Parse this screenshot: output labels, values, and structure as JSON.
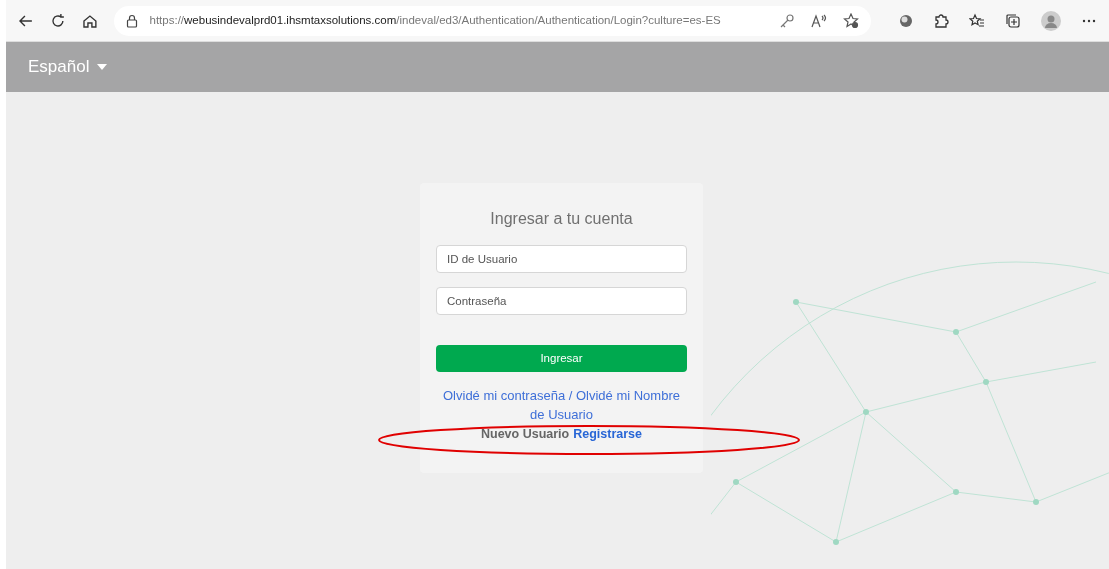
{
  "browser": {
    "url": {
      "scheme": "https://",
      "host": "webusindevalprd01.ihsmtaxsolutions.com",
      "path": "/indeval/ed3/Authentication/Authentication/Login?culture=es-ES"
    }
  },
  "navbar": {
    "language": "Español"
  },
  "login": {
    "title": "Ingresar a tu cuenta",
    "fields": [
      {
        "placeholder": "ID de Usuario"
      },
      {
        "placeholder": "Contraseña"
      }
    ],
    "submit": "Ingresar",
    "recovery": {
      "first": "Olvidé mi contraseña",
      "separator": "/",
      "second": "Olvidé mi Nombre de Usuario"
    },
    "register": {
      "label": "Nuevo Usuario",
      "link": "Registrarse",
      "circled": true
    }
  }
}
